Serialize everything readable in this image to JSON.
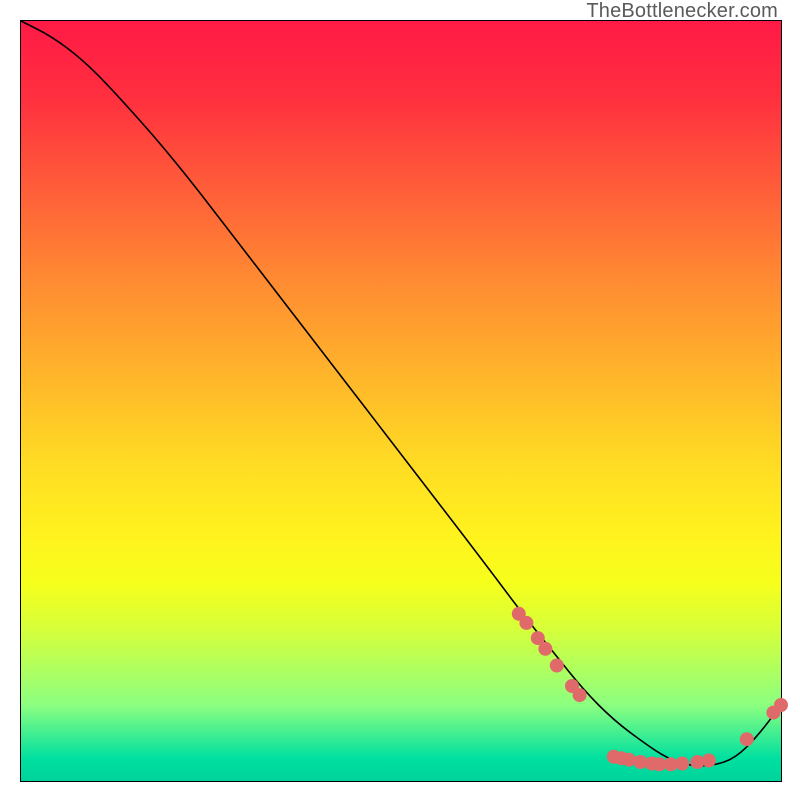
{
  "credit_text": "TheBottlenecker.com",
  "colors": {
    "curve_stroke": "#000000",
    "marker_fill": "#e06a6a",
    "marker_stroke": "#c94f4f"
  },
  "chart_data": {
    "type": "line",
    "title": "",
    "xlabel": "",
    "ylabel": "",
    "xlim": [
      0,
      100
    ],
    "ylim": [
      0,
      100
    ],
    "grid": false,
    "legend": false,
    "series": [
      {
        "name": "curve",
        "x": [
          0,
          4,
          8,
          12,
          20,
          30,
          40,
          50,
          60,
          66,
          70,
          74,
          78,
          82,
          85,
          88,
          91,
          94,
          97,
          100
        ],
        "y": [
          100,
          98,
          95,
          91,
          82,
          69,
          56,
          43,
          30,
          22,
          17,
          12,
          8,
          5,
          3,
          2,
          2,
          3,
          6,
          10
        ]
      }
    ],
    "markers": [
      {
        "x": 65.5,
        "y": 22.0
      },
      {
        "x": 66.5,
        "y": 20.8
      },
      {
        "x": 68.0,
        "y": 18.8
      },
      {
        "x": 69.0,
        "y": 17.4
      },
      {
        "x": 70.5,
        "y": 15.2
      },
      {
        "x": 72.5,
        "y": 12.5
      },
      {
        "x": 73.5,
        "y": 11.3
      },
      {
        "x": 78.0,
        "y": 3.2
      },
      {
        "x": 79.0,
        "y": 3.0
      },
      {
        "x": 80.0,
        "y": 2.8
      },
      {
        "x": 81.5,
        "y": 2.5
      },
      {
        "x": 83.0,
        "y": 2.3
      },
      {
        "x": 84.0,
        "y": 2.2
      },
      {
        "x": 85.5,
        "y": 2.2
      },
      {
        "x": 87.0,
        "y": 2.3
      },
      {
        "x": 89.0,
        "y": 2.5
      },
      {
        "x": 90.5,
        "y": 2.7
      },
      {
        "x": 95.5,
        "y": 5.5
      },
      {
        "x": 99.0,
        "y": 9.0
      },
      {
        "x": 100.0,
        "y": 10.0
      }
    ]
  }
}
